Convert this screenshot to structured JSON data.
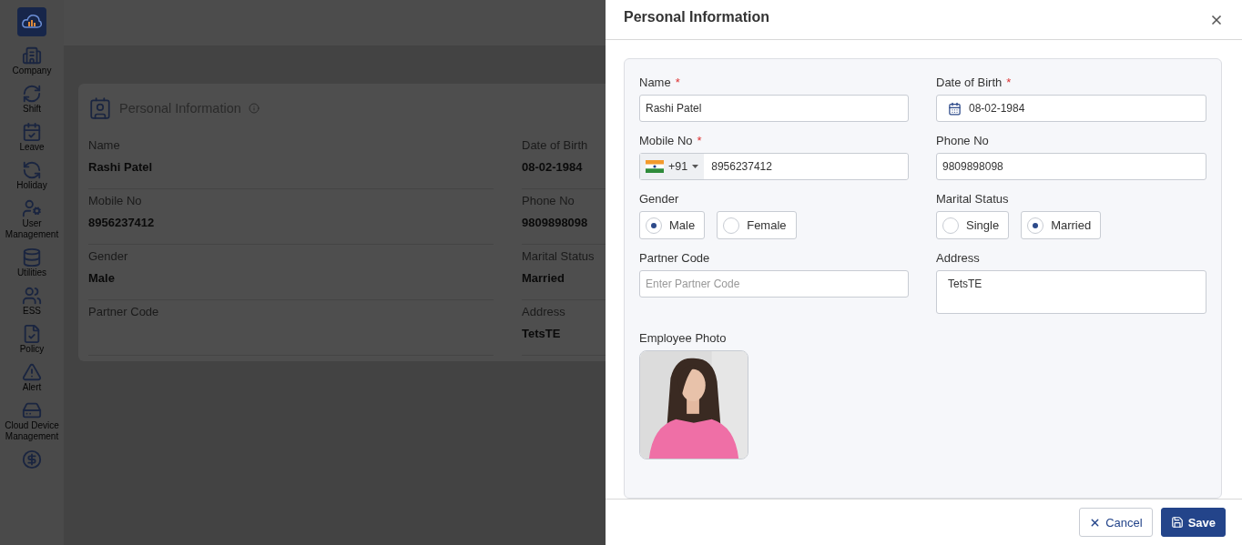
{
  "sidebar": {
    "items": [
      {
        "label": "Company"
      },
      {
        "label": "Shift"
      },
      {
        "label": "Leave"
      },
      {
        "label": "Holiday"
      },
      {
        "label": "User Management"
      },
      {
        "label": "Utilities"
      },
      {
        "label": "ESS"
      },
      {
        "label": "Policy"
      },
      {
        "label": "Alert"
      },
      {
        "label": "Cloud Device Management"
      }
    ]
  },
  "page": {
    "card": {
      "title": "Personal Information",
      "fields": [
        {
          "label": "Name",
          "value": "Rashi Patel"
        },
        {
          "label": "Date of Birth",
          "value": "08-02-1984"
        },
        {
          "label": "Mobile No",
          "value": "8956237412"
        },
        {
          "label": "Phone No",
          "value": "9809898098"
        },
        {
          "label": "Gender",
          "value": "Male"
        },
        {
          "label": "Marital Status",
          "value": "Married"
        },
        {
          "label": "Partner Code"
        },
        {
          "label": "Address",
          "value": "TetsTE"
        }
      ]
    }
  },
  "drawer": {
    "title": "Personal Information",
    "fields": [
      {
        "kind": "text",
        "label": "Name",
        "required_mark": "*",
        "value": "Rashi Patel"
      },
      {
        "kind": "date",
        "label": "Date of Birth",
        "required_mark": "*",
        "value": "08-02-1984"
      },
      {
        "kind": "phone",
        "label": "Mobile No",
        "required_mark": "*",
        "code": "+91",
        "value": "8956237412"
      },
      {
        "kind": "text",
        "label": "Phone No",
        "value": "9809898098"
      },
      {
        "kind": "radio",
        "label": "Gender",
        "options": [
          {
            "label": "Male",
            "selected": true
          },
          {
            "label": "Female",
            "selected": false
          }
        ]
      },
      {
        "kind": "radio",
        "label": "Marital Status",
        "options": [
          {
            "label": "Single",
            "selected": false
          },
          {
            "label": "Married",
            "selected": true
          }
        ]
      },
      {
        "kind": "text",
        "label": "Partner Code",
        "placeholder": "Enter Partner Code"
      },
      {
        "kind": "textarea",
        "label": "Address",
        "value": "TetsTE"
      },
      {
        "label": "Employee Photo"
      }
    ],
    "buttons": [
      {
        "kind": "cancel",
        "label": "Cancel"
      },
      {
        "kind": "save",
        "label": "Save"
      }
    ]
  }
}
